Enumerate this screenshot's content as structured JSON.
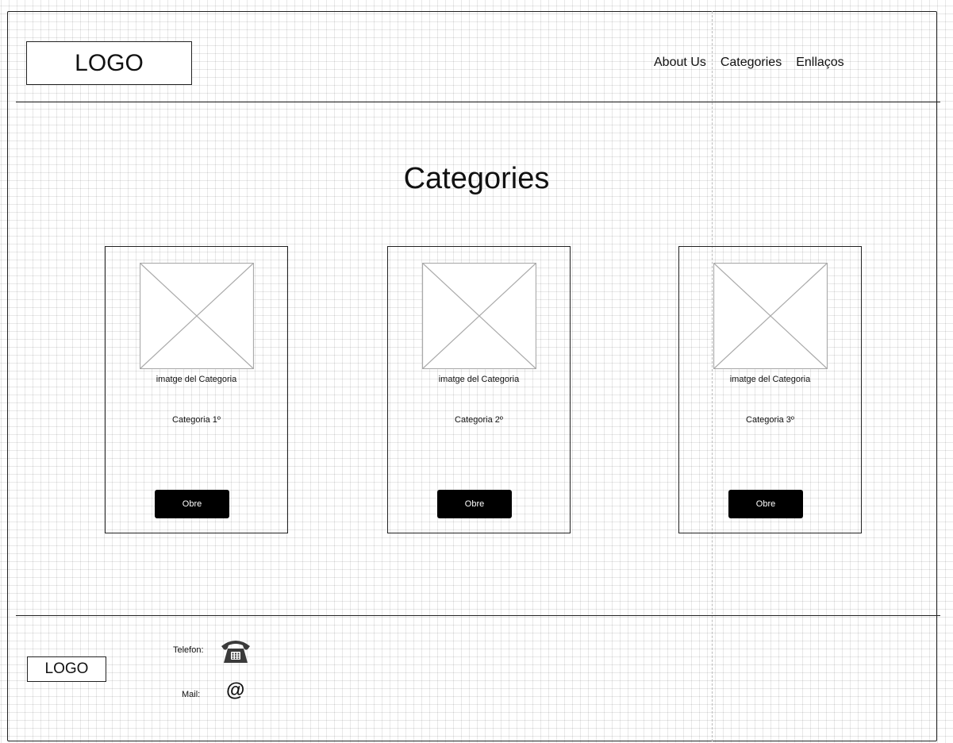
{
  "header": {
    "logo": "LOGO",
    "nav": [
      "About Us",
      "Categories",
      "Enllaços"
    ]
  },
  "main": {
    "title": "Categories",
    "cards": [
      {
        "image_caption": "imatge del Categoria",
        "name": "Categoria 1º",
        "button": "Obre"
      },
      {
        "image_caption": "imatge del Categoria",
        "name": "Categoria 2º",
        "button": "Obre"
      },
      {
        "image_caption": "imatge del Categoria",
        "name": "Categoria 3º",
        "button": "Obre"
      }
    ]
  },
  "footer": {
    "logo": "LOGO",
    "phone_label": "Telefon:",
    "phone_icon": "phone-icon",
    "mail_label": "Mail:",
    "mail_icon": "at-icon"
  },
  "colors": {
    "button_bg": "#000000",
    "button_text": "#ffffff",
    "line": "#222222",
    "placeholder_stroke": "#aaaaaa"
  }
}
